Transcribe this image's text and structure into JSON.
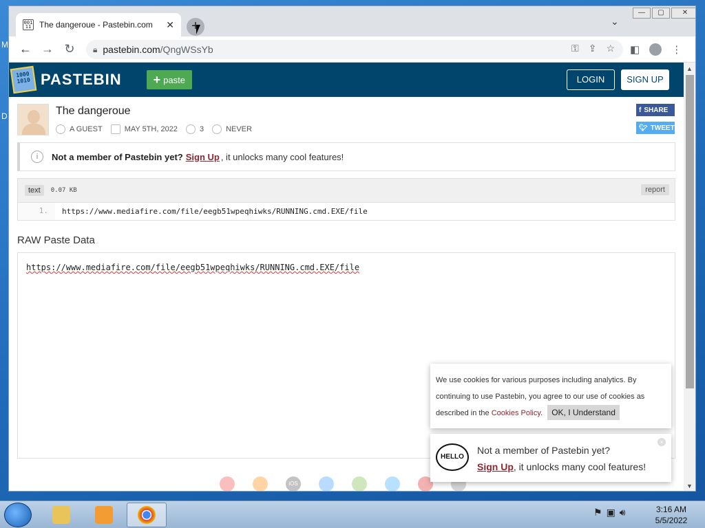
{
  "desktop": {
    "label_m": "M",
    "label_d": "D"
  },
  "browser": {
    "tab_title": "The dangeroue - Pastebin.com",
    "favicon_text": "001 11",
    "tab_close": "✕",
    "new_tab": "+",
    "tab_menu": "⌄",
    "win_min": "—",
    "win_max": "▢",
    "win_close": "✕",
    "url_domain": "pastebin.com",
    "url_path": "/QngWSsYb"
  },
  "site": {
    "logo_text": "PASTEBIN",
    "logo_icon_text": "1000 1010",
    "paste_label": "paste",
    "login_label": "LOGIN",
    "signup_label": "SIGN UP"
  },
  "paste": {
    "title": "The dangeroue",
    "author": "A GUEST",
    "date": "MAY 5TH, 2022",
    "views": "3",
    "expiry": "NEVER",
    "share_label": "SHARE",
    "tweet_label": "TWEET"
  },
  "notice": {
    "bold": "Not a member of Pastebin yet?",
    "link": "Sign Up",
    "rest": ", it unlocks many cool features!",
    "icon": "i"
  },
  "code": {
    "syntax": "text",
    "size": "0.07 KB",
    "report_label": "report",
    "line_number": "1.",
    "line": "https://www.mediafire.com/file/eegb51wpeqhiwks/RUNNING.cmd.EXE/file"
  },
  "raw": {
    "title": "RAW Paste Data",
    "text": "https://www.mediafire.com/file/eegb51wpeqhiwks/RUNNING.cmd.EXE/file"
  },
  "footer_icons": [
    "chrome",
    "firefox",
    "iOS",
    "windows",
    "android",
    "x",
    "opera",
    "arch"
  ],
  "cookie": {
    "text_1": "We use cookies for various purposes including analytics. By continuing to use Pastebin, you agree to our use of cookies as described in the",
    "link": "Cookies Policy",
    "period": ".",
    "button": "OK, I Understand"
  },
  "member_popup": {
    "line1": "Not a member of Pastebin yet?",
    "link": "Sign Up",
    "line2": ", it unlocks many cool features!",
    "hello": "HELLO"
  },
  "taskbar": {
    "time": "3:16 AM",
    "date": "5/5/2022"
  },
  "colors": {
    "header": "#02456c",
    "paste_green": "#4fa952",
    "link_red": "#8d2731"
  }
}
